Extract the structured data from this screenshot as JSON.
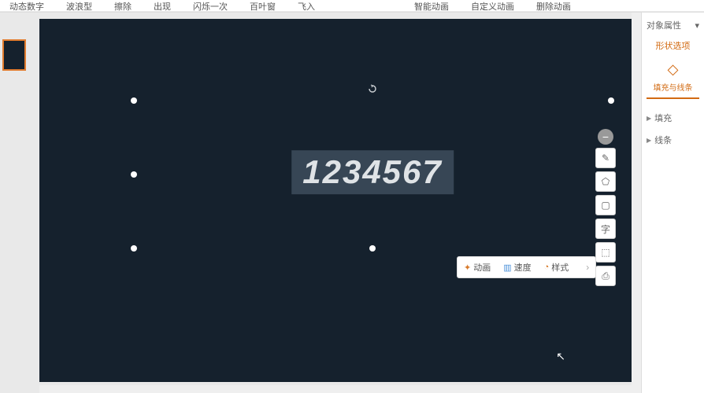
{
  "ribbon": {
    "items": [
      "动态数字",
      "波浪型",
      "擦除",
      "出现",
      "闪烁一次",
      "百叶窗",
      "飞入"
    ],
    "right": [
      "智能动画",
      "自定义动画",
      "删除动画"
    ]
  },
  "textbox": {
    "value": "1234567"
  },
  "context_bar": {
    "anim": "动画",
    "speed": "速度",
    "style": "样式"
  },
  "float_tools": {
    "minus": "−",
    "items": [
      "✎",
      "⬠",
      "▢",
      "字",
      "⬚",
      "⎙"
    ]
  },
  "side": {
    "title": "对象属性",
    "shape_tab": "形状选项",
    "fill_line": "填充与线条",
    "sections": [
      "填充",
      "线条"
    ]
  }
}
